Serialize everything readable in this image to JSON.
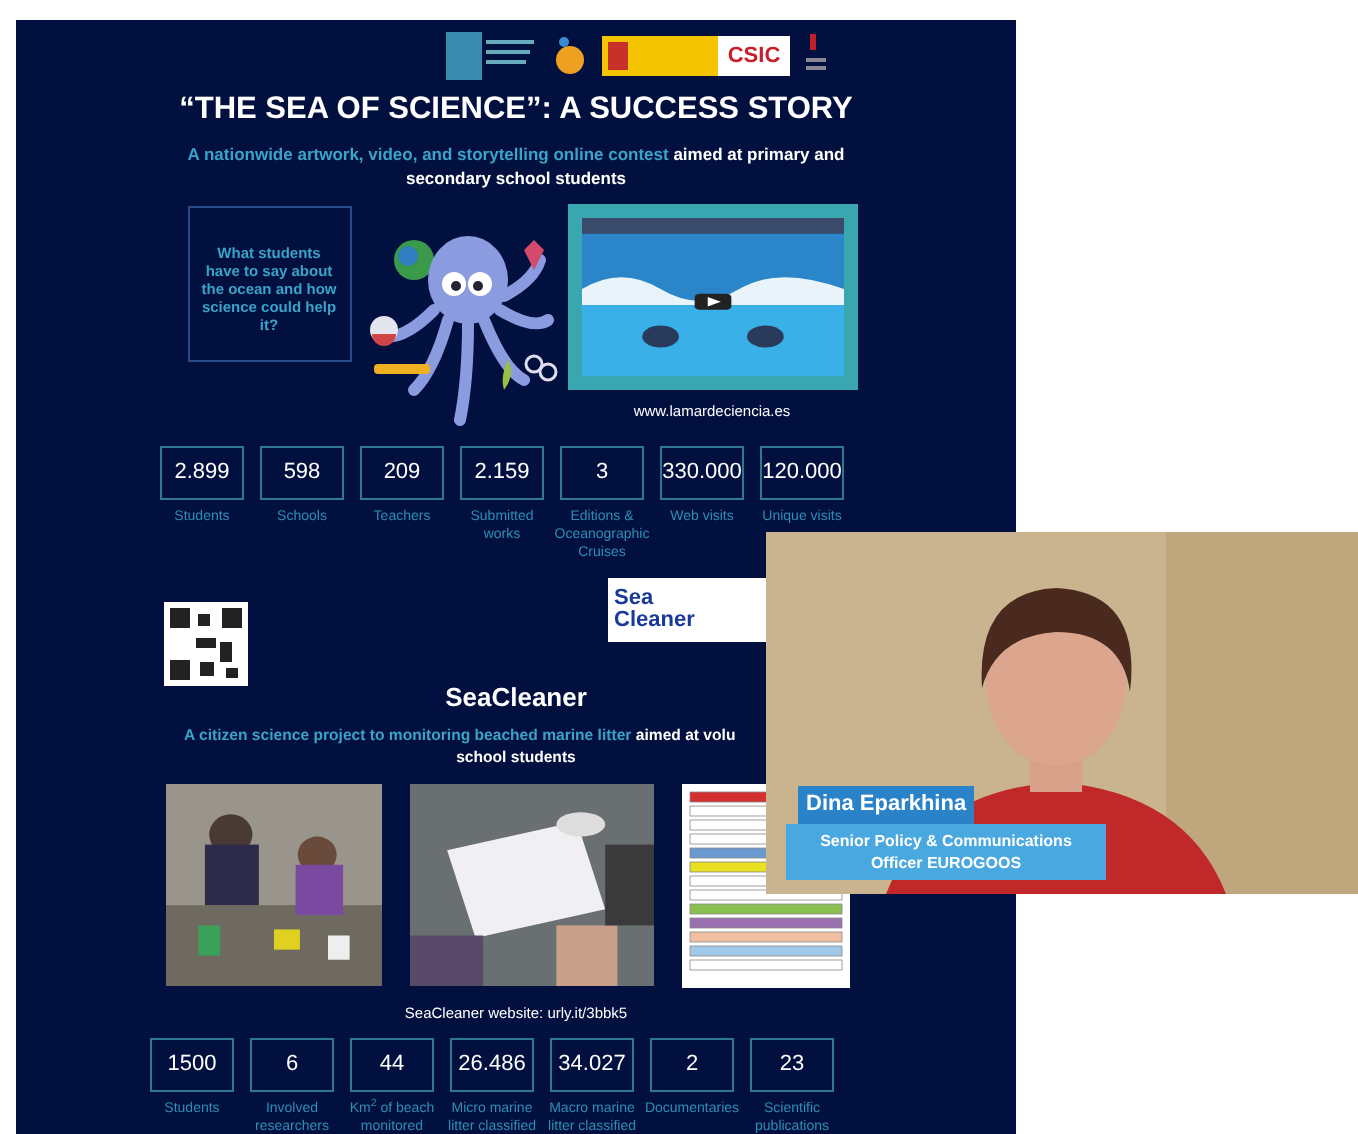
{
  "slide": {
    "logos": {
      "csic": "CSIC"
    },
    "title": "“THE SEA OF SCIENCE”: A SUCCESS STORY",
    "subtitle": {
      "highlight": "A nationwide artwork, video, and storytelling online contest",
      "rest": " aimed at primary and secondary school students"
    },
    "bubble": "What students have to say about the ocean and how science could help it?",
    "video_link": "www.lamardeciencia.es",
    "stats": [
      {
        "value": "2.899",
        "label": "Students"
      },
      {
        "value": "598",
        "label": "Schools"
      },
      {
        "value": "209",
        "label": "Teachers"
      },
      {
        "value": "2.159",
        "label": "Submitted works"
      },
      {
        "value": "3",
        "label": "Editions & Oceanographic Cruises"
      },
      {
        "value": "330.000",
        "label": "Web visits"
      },
      {
        "value": "120.000",
        "label": "Unique visits"
      }
    ],
    "seacleaner_logo": {
      "line1": "Sea",
      "line2": "Cleaner"
    },
    "section_title": "SeaCleaner",
    "section_subtitle": {
      "highlight": "A citizen science project to monitoring beached marine litter",
      "rest": " aimed at volu",
      "line2": "school students"
    },
    "website": "SeaCleaner website: urly.it/3bbk5",
    "stats2": [
      {
        "value": "1500",
        "label": "Students"
      },
      {
        "value": "6",
        "label": "Involved researchers"
      },
      {
        "value": "44",
        "label": "Km$^{2}$ of beach monitored"
      },
      {
        "value": "26.486",
        "label": "Micro marine litter classified"
      },
      {
        "value": "34.027",
        "label": "Macro marine litter classified"
      },
      {
        "value": "2",
        "label": "Documentaries"
      },
      {
        "value": "23",
        "label": "Scientific publications"
      }
    ]
  },
  "speaker": {
    "name": "Dina Eparkhina",
    "role": "Senior Policy & Communications Officer EUROGOOS"
  }
}
